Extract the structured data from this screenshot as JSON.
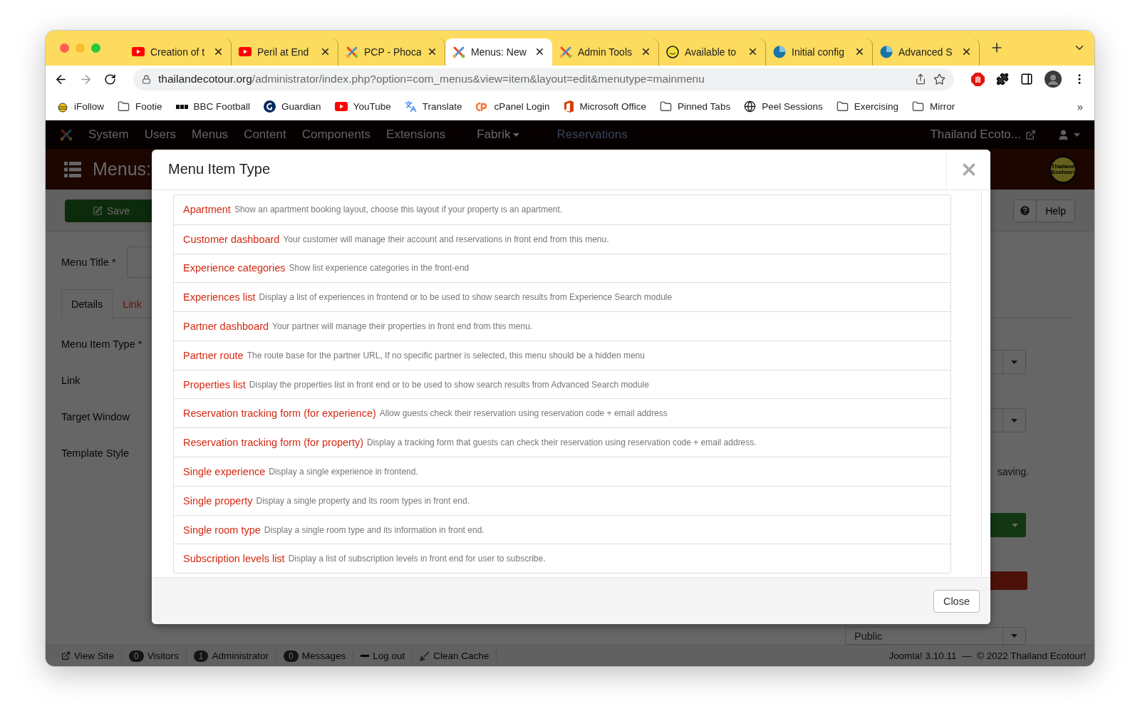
{
  "browser": {
    "tabs": [
      {
        "title": "Creation of t",
        "kind": "youtube",
        "selected": false
      },
      {
        "title": "Peril at End",
        "kind": "youtube",
        "selected": false
      },
      {
        "title": "PCP - Phoca",
        "kind": "joomla",
        "selected": false
      },
      {
        "title": "Menus: New",
        "kind": "joomla",
        "selected": true
      },
      {
        "title": "Admin Tools",
        "kind": "joomla",
        "selected": false
      },
      {
        "title": "Available to",
        "kind": "smiley",
        "selected": false
      },
      {
        "title": "Initial config",
        "kind": "pie",
        "selected": false
      },
      {
        "title": "Advanced S",
        "kind": "pie",
        "selected": false
      }
    ],
    "url": {
      "host": "thailandecotour.org",
      "path": "/administrator/index.php?option=com_menus&view=item&layout=edit&menutype=mainmenu"
    },
    "bookmarks": [
      {
        "label": "iFollow",
        "kind": "app"
      },
      {
        "label": "Footie",
        "kind": "folder"
      },
      {
        "label": "BBC Football",
        "kind": "dots"
      },
      {
        "label": "Guardian",
        "kind": "guardian"
      },
      {
        "label": "YouTube",
        "kind": "youtube"
      },
      {
        "label": "Translate",
        "kind": "translate"
      },
      {
        "label": "cPanel Login",
        "kind": "cpanel"
      },
      {
        "label": "Microsoft Office",
        "kind": "office"
      },
      {
        "label": "Pinned Tabs",
        "kind": "folder"
      },
      {
        "label": "Peel Sessions",
        "kind": "globe"
      },
      {
        "label": "Exercising",
        "kind": "folder"
      },
      {
        "label": "Mirror",
        "kind": "folder"
      }
    ],
    "more_bookmarks": "»"
  },
  "admin": {
    "nav": [
      {
        "label": "System",
        "kind": "link"
      },
      {
        "label": "Users",
        "kind": "link"
      },
      {
        "label": "Menus",
        "kind": "link"
      },
      {
        "label": "Content",
        "kind": "link"
      },
      {
        "label": "Components",
        "kind": "link"
      },
      {
        "label": "Extensions",
        "kind": "link"
      },
      {
        "label": "Fabrik",
        "kind": "dropdown"
      },
      {
        "label": "Reservations",
        "kind": "muted"
      }
    ],
    "site_link": "Thailand Ecoto...",
    "page_title": "Menus:",
    "logo_text": "Thailand Ecotour!",
    "save": "Save",
    "help": "Help",
    "title_label": "Menu Title *",
    "form_tabs": [
      {
        "label": "Details",
        "selected": true
      },
      {
        "label": "Link",
        "selected": false
      }
    ],
    "labels": [
      "Menu Item Type *",
      "Link",
      "Target Window",
      "Template Style"
    ],
    "help_fragment": "saving.",
    "access_value": "Public",
    "status_left": [
      {
        "label": "View Site",
        "kind": "link"
      },
      {
        "count": "0",
        "label": "Visitors",
        "kind": "badge"
      },
      {
        "count": "1",
        "label": "Administrator",
        "kind": "badge"
      },
      {
        "count": "0",
        "label": "Messages",
        "kind": "badge"
      },
      {
        "label": "Log out",
        "kind": "logout"
      },
      {
        "label": "Clean Cache",
        "kind": "cache"
      }
    ],
    "status_right": "Joomla! 3.10.11  —  © 2022 Thailand Ecotour!"
  },
  "modal": {
    "title": "Menu Item Type",
    "items": [
      {
        "name": "Apartment",
        "description": "Show an apartment booking layout, choose this layout if your property is an apartment."
      },
      {
        "name": "Customer dashboard",
        "description": "Your customer will manage their account and reservations in front end from this menu."
      },
      {
        "name": "Experience categories",
        "description": "Show list experience categories in the front-end"
      },
      {
        "name": "Experiences list",
        "description": "Display a list of experiences in frontend or to be used to show search results from Experience Search module"
      },
      {
        "name": "Partner dashboard",
        "description": "Your partner will manage their properties in front end from this menu."
      },
      {
        "name": "Partner route",
        "description": "The route base for the partner URL, If no specific partner is selected, this menu should be a hidden menu"
      },
      {
        "name": "Properties list",
        "description": "Display the properties list in front end or to be used to show search results from Advanced Search module"
      },
      {
        "name": "Reservation tracking form (for experience)",
        "description": "Allow guests check their reservation using reservation code + email address"
      },
      {
        "name": "Reservation tracking form (for property)",
        "description": "Display a tracking form that guests can check their reservation using reservation code + email address."
      },
      {
        "name": "Single experience",
        "description": "Display a single experience in frontend."
      },
      {
        "name": "Single property",
        "description": "Display a single property and its room types in front end."
      },
      {
        "name": "Single room type",
        "description": "Display a single room type and its information in front end."
      },
      {
        "name": "Subscription levels list",
        "description": "Display a list of subscription levels in front end for user to subscribe."
      }
    ],
    "close": "Close"
  }
}
